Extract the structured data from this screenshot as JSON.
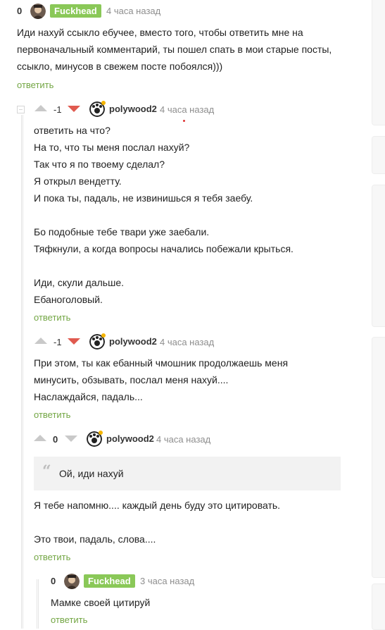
{
  "comments": [
    {
      "rating": "0",
      "author": "Fuckhead",
      "time": "4 часа назад",
      "text": "Иди нахуй ссыкло ебучее, вместо того, чтобы ответить мне на\nпервоначальный комментарий, ты пошел спать в мои старые посты,\nссыкло, минусов в свежем посте побоялся)))",
      "reply": "ответить"
    },
    {
      "rating": "-1",
      "author": "polywood2",
      "time": "4 часа назад",
      "text": "ответить на что?\nНа то, что ты меня послал нахуй?\nТак что я по твоему сделал?\nЯ открыл вендетту.\nИ пока ты, падаль, не извинишься я тебя заебу.\n\nБо подобные тебе твари уже заебали.\nТяфкнули, а когда вопросы начались побежали крыться.\n\nИди, скули дальше.\nЕбаноголовый.",
      "reply": "ответить"
    },
    {
      "rating": "-1",
      "author": "polywood2",
      "time": "4 часа назад",
      "text": "При этом, ты как ебанный чмошник продолжаешь меня\nминусить, обзывать, послал меня нахуй....\nНаслаждайся, падаль...",
      "reply": "ответить"
    },
    {
      "rating": "0",
      "author": "polywood2",
      "time": "4 часа назад",
      "quote": "Ой, иди нахуй",
      "text": "Я тебе напомню.... каждый день буду это цитировать.\n\nЭто твои, падаль, слова....",
      "reply": "ответить"
    },
    {
      "rating": "0",
      "author": "Fuckhead",
      "time": "3 часа назад",
      "text": "Мамке своей цитируй",
      "reply": "ответить"
    }
  ],
  "icons": {
    "upvote": "arrow-up-icon",
    "downvote": "arrow-down-icon",
    "collapse": "collapse-icon",
    "quote": "quote-icon"
  },
  "colors": {
    "badge": "#8ac858",
    "reply_link": "#73a644",
    "downvote_active": "#e05a4f",
    "online_dot": "#f4b400"
  }
}
